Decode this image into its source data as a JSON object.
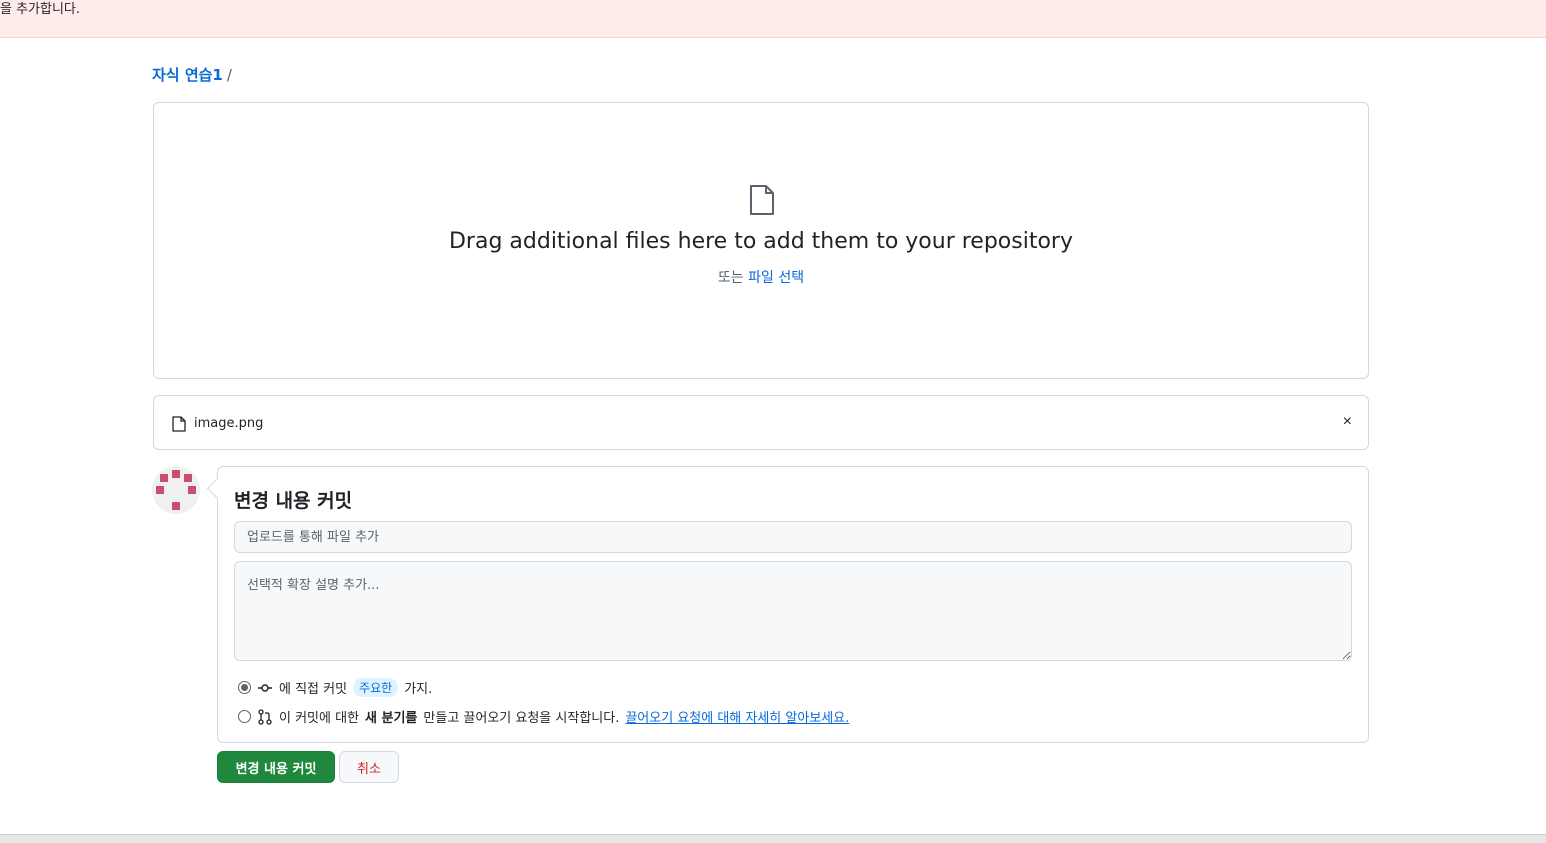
{
  "banner": {
    "text": "을 추가합니다."
  },
  "breadcrumb": {
    "repo": "자식 연습1",
    "separator": "/"
  },
  "dropzone": {
    "heading": "Drag additional files here to add them to your repository",
    "or_text": "또는",
    "choose_link": "파일 선택"
  },
  "file": {
    "name": "image.png",
    "remove_label": "×"
  },
  "commit": {
    "title": "변경 내용 커밋",
    "summary_placeholder": "업로드를 통해 파일 추가",
    "description_placeholder": "선택적 확장 설명 추가...",
    "option_direct": {
      "prefix": "에 직접 커밋",
      "branch": "주요한",
      "suffix": "가지."
    },
    "option_branch": {
      "prefix": "이 커밋에 대한",
      "bold": "새 분기를",
      "middle": "만들고 끌어오기 요청을 시작합니다.",
      "link": "끌어오기 요청에 대해 자세히 알아보세요."
    },
    "commit_button": "변경 내용 커밋",
    "cancel_button": "취소"
  },
  "colors": {
    "primary": "#1f883d",
    "link": "#0969da",
    "danger": "#d1242f",
    "banner": "#ffebe9"
  }
}
